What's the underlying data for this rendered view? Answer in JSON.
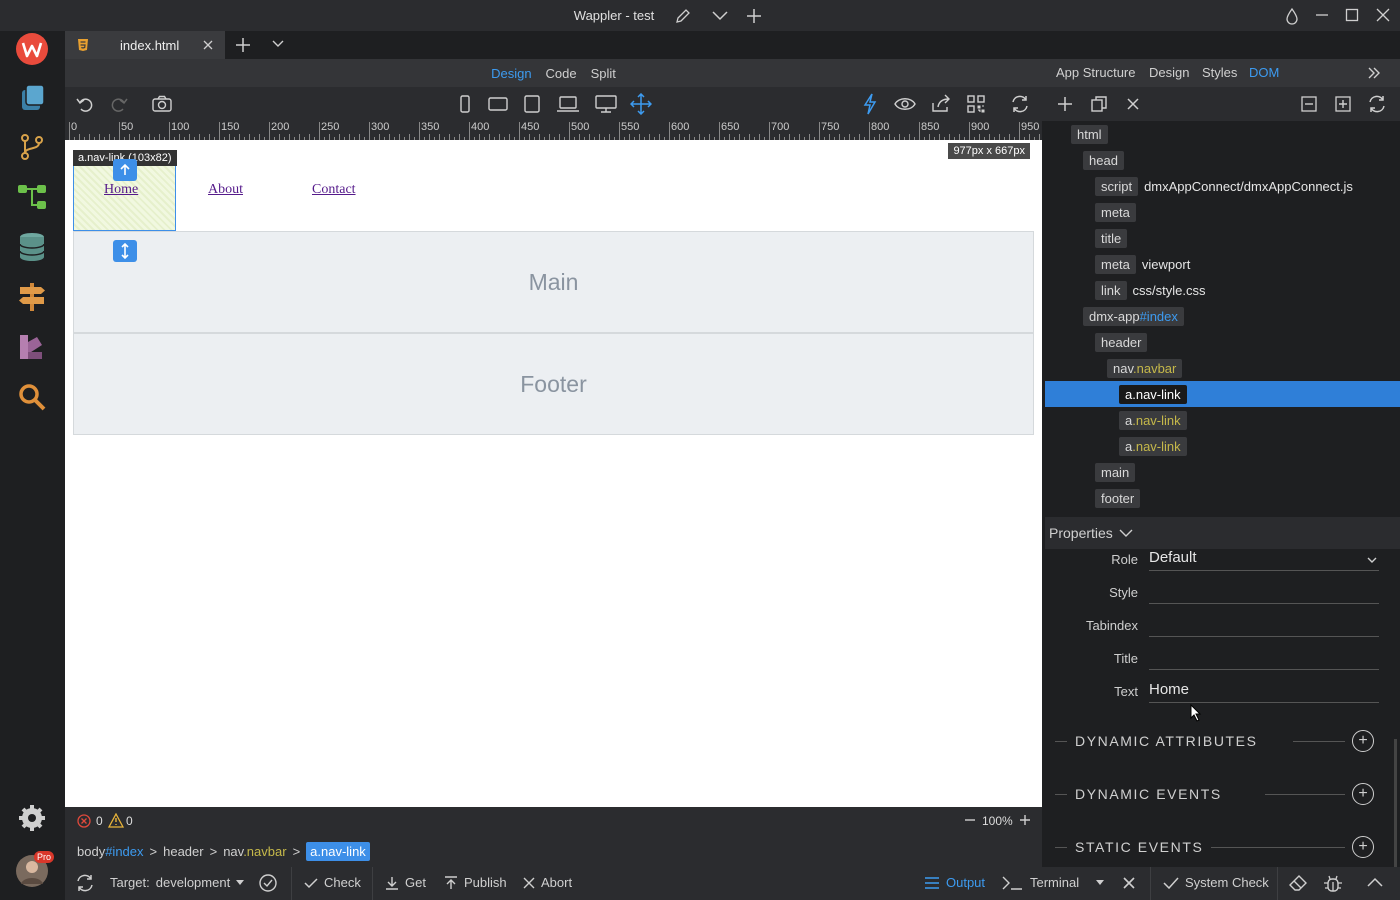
{
  "window": {
    "title": "Wappler - test"
  },
  "tabs": [
    {
      "label": "index.html"
    }
  ],
  "editor": {
    "modes": [
      "Design",
      "Code",
      "Split"
    ],
    "active_mode": "Design",
    "ruler_labels": [
      "0",
      "50",
      "100",
      "150",
      "200",
      "250",
      "300",
      "350",
      "400",
      "450",
      "500",
      "550",
      "600",
      "650",
      "700",
      "750",
      "800",
      "850",
      "900",
      "950"
    ],
    "canvas_size": "977px x 667px",
    "selection_label": "a.nav-link (103x82)",
    "nav_links": [
      "Home",
      "About",
      "Contact"
    ],
    "sections": [
      "Main",
      "Footer"
    ],
    "errors": "0",
    "warnings": "0",
    "zoom": "100%"
  },
  "breadcrumb": [
    {
      "tag": "body",
      "suffix": "#index",
      "suffix_kind": "id"
    },
    {
      "tag": "header",
      "suffix": "",
      "suffix_kind": ""
    },
    {
      "tag": "nav",
      "suffix": ".navbar",
      "suffix_kind": "class"
    },
    {
      "tag": "a",
      "suffix": ".nav-link",
      "suffix_kind": "class",
      "active": true
    }
  ],
  "right_panel": {
    "tabs": [
      "App Structure",
      "Design",
      "Styles",
      "DOM"
    ],
    "active_tab": "DOM",
    "dom": [
      {
        "tag": "html",
        "depth": 0
      },
      {
        "tag": "head",
        "depth": 1
      },
      {
        "tag": "script",
        "depth": 2,
        "attr": "dmxAppConnect/dmxAppConnect.js"
      },
      {
        "tag": "meta",
        "depth": 2
      },
      {
        "tag": "title",
        "depth": 2
      },
      {
        "tag": "meta",
        "depth": 2,
        "attr": "viewport"
      },
      {
        "tag": "link",
        "depth": 2,
        "attr": "css/style.css"
      },
      {
        "tag": "dmx-app",
        "id": "#index",
        "depth": 1
      },
      {
        "tag": "header",
        "depth": 2
      },
      {
        "tag": "nav",
        "cls": ".navbar",
        "depth": 3
      },
      {
        "tag": "a",
        "cls": ".nav-link",
        "depth": 4,
        "selected": true
      },
      {
        "tag": "a",
        "cls": ".nav-link",
        "depth": 4
      },
      {
        "tag": "a",
        "cls": ".nav-link",
        "depth": 4
      },
      {
        "tag": "main",
        "depth": 2
      },
      {
        "tag": "footer",
        "depth": 2
      }
    ],
    "properties_title": "Properties",
    "properties": [
      {
        "label": "Role",
        "value": "Default",
        "dropdown": true
      },
      {
        "label": "Style",
        "value": ""
      },
      {
        "label": "Tabindex",
        "value": ""
      },
      {
        "label": "Title",
        "value": ""
      },
      {
        "label": "Text",
        "value": "Home"
      }
    ],
    "sections": [
      "DYNAMIC ATTRIBUTES",
      "DYNAMIC EVENTS",
      "STATIC EVENTS"
    ]
  },
  "bottom_bar": {
    "target_label": "Target:",
    "target_value": "development",
    "check": "Check",
    "get": "Get",
    "publish": "Publish",
    "abort": "Abort",
    "output": "Output",
    "terminal": "Terminal",
    "system_check": "System Check"
  },
  "user": {
    "badge": "Pro"
  },
  "colors": {
    "accent": "#3d9bf0",
    "selection": "#2f7fd8",
    "class_color": "#c5b84a",
    "brand": "#e94b3c"
  }
}
